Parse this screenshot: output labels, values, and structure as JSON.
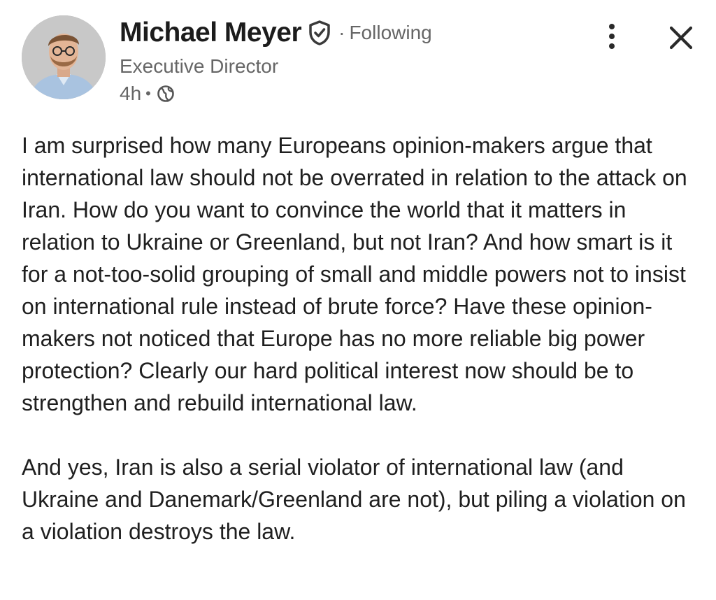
{
  "post": {
    "author": {
      "name": "Michael Meyer",
      "follow_status": "Following",
      "headline": "Executive Director",
      "verified": true
    },
    "timestamp": "4h",
    "visibility_icon": "globe-icon",
    "body": {
      "paragraph_1": "I am surprised how many Europeans opinion-makers argue that international law should not be overrated in relation to the attack on Iran. How do you want to convince the world that it matters in relation to Ukraine or Greenland, but not Iran? And how smart is it for a not-too-solid grouping of small and middle powers not to insist on international rule instead of brute force? Have these opinion-makers not noticed that Europe has no more reliable big power protection? Clearly our hard political interest now should be to strengthen and rebuild international law.",
      "paragraph_2": "And yes, Iran is also a serial violator of international law (and Ukraine and Danemark/Greenland are not), but piling a violation on a violation destroys the law."
    }
  },
  "controls": {
    "more_icon": "more-vertical-icon",
    "close_icon": "close-icon"
  },
  "colors": {
    "text": "#1f1f1f",
    "secondary_text": "#666666",
    "background": "#ffffff"
  }
}
